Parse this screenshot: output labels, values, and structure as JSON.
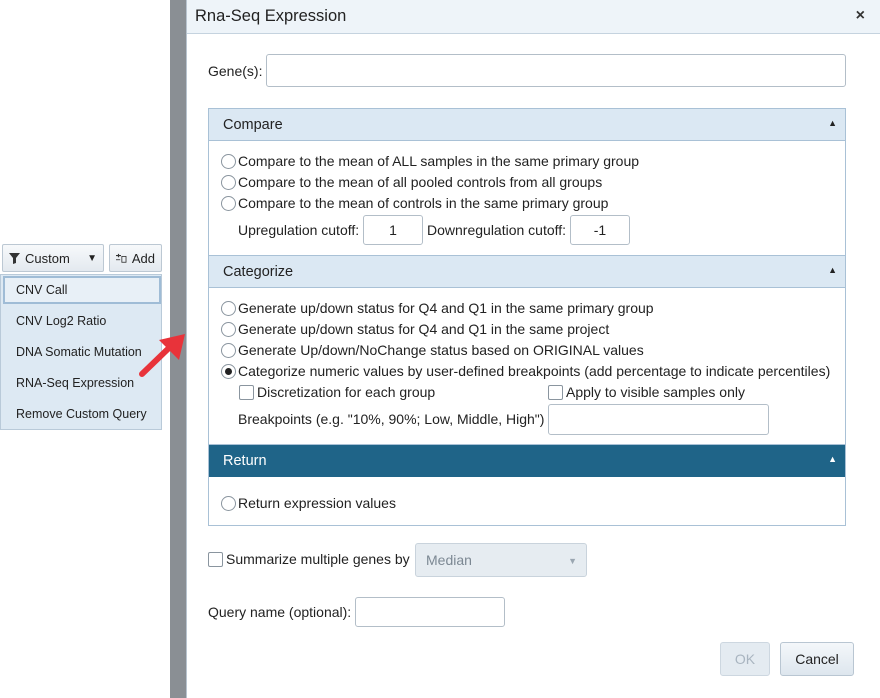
{
  "background": {
    "toolbar": {
      "custom_label": "Custom",
      "add_label": "Add"
    },
    "menu": {
      "items": [
        {
          "label": "CNV Call"
        },
        {
          "label": "CNV Log2 Ratio"
        },
        {
          "label": "DNA Somatic Mutation"
        },
        {
          "label": "RNA-Seq Expression"
        },
        {
          "label": "Remove Custom Query"
        }
      ]
    },
    "arrow_color": "#e8333a"
  },
  "dialog": {
    "title": "Rna-Seq Expression",
    "close_glyph": "×",
    "genes_label": "Gene(s):",
    "genes_value": "",
    "compare": {
      "title": "Compare",
      "options": [
        "Compare to the mean of ALL samples in the same primary group",
        "Compare to the mean of all pooled controls from all groups",
        "Compare to the mean of controls in the same primary group"
      ],
      "up_label": "Upregulation cutoff:",
      "up_value": "1",
      "down_label": "Downregulation cutoff:",
      "down_value": "-1"
    },
    "categorize": {
      "title": "Categorize",
      "options": [
        "Generate up/down status for Q4 and Q1 in the same primary group",
        "Generate up/down status for Q4 and Q1 in the same project",
        "Generate Up/down/NoChange status based on ORIGINAL values",
        "Categorize numeric values by user-defined breakpoints (add percentage to indicate percentiles)"
      ],
      "selected_index": 3,
      "discretization_label": "Discretization for each group",
      "visible_only_label": "Apply to visible samples only",
      "breakpoints_label": "Breakpoints (e.g. \"10%, 90%; Low, Middle, High\")",
      "breakpoints_value": ""
    },
    "return_panel": {
      "title": "Return",
      "option": "Return expression values"
    },
    "summarize_label": "Summarize multiple genes by",
    "summarize_select": "Median",
    "query_name_label": "Query name (optional):",
    "query_name_value": "",
    "ok_label": "OK",
    "cancel_label": "Cancel",
    "colors": {
      "header_bg": "#eef4f9",
      "panel_head": "#dbe8f3",
      "return_head": "#1f6488"
    }
  }
}
